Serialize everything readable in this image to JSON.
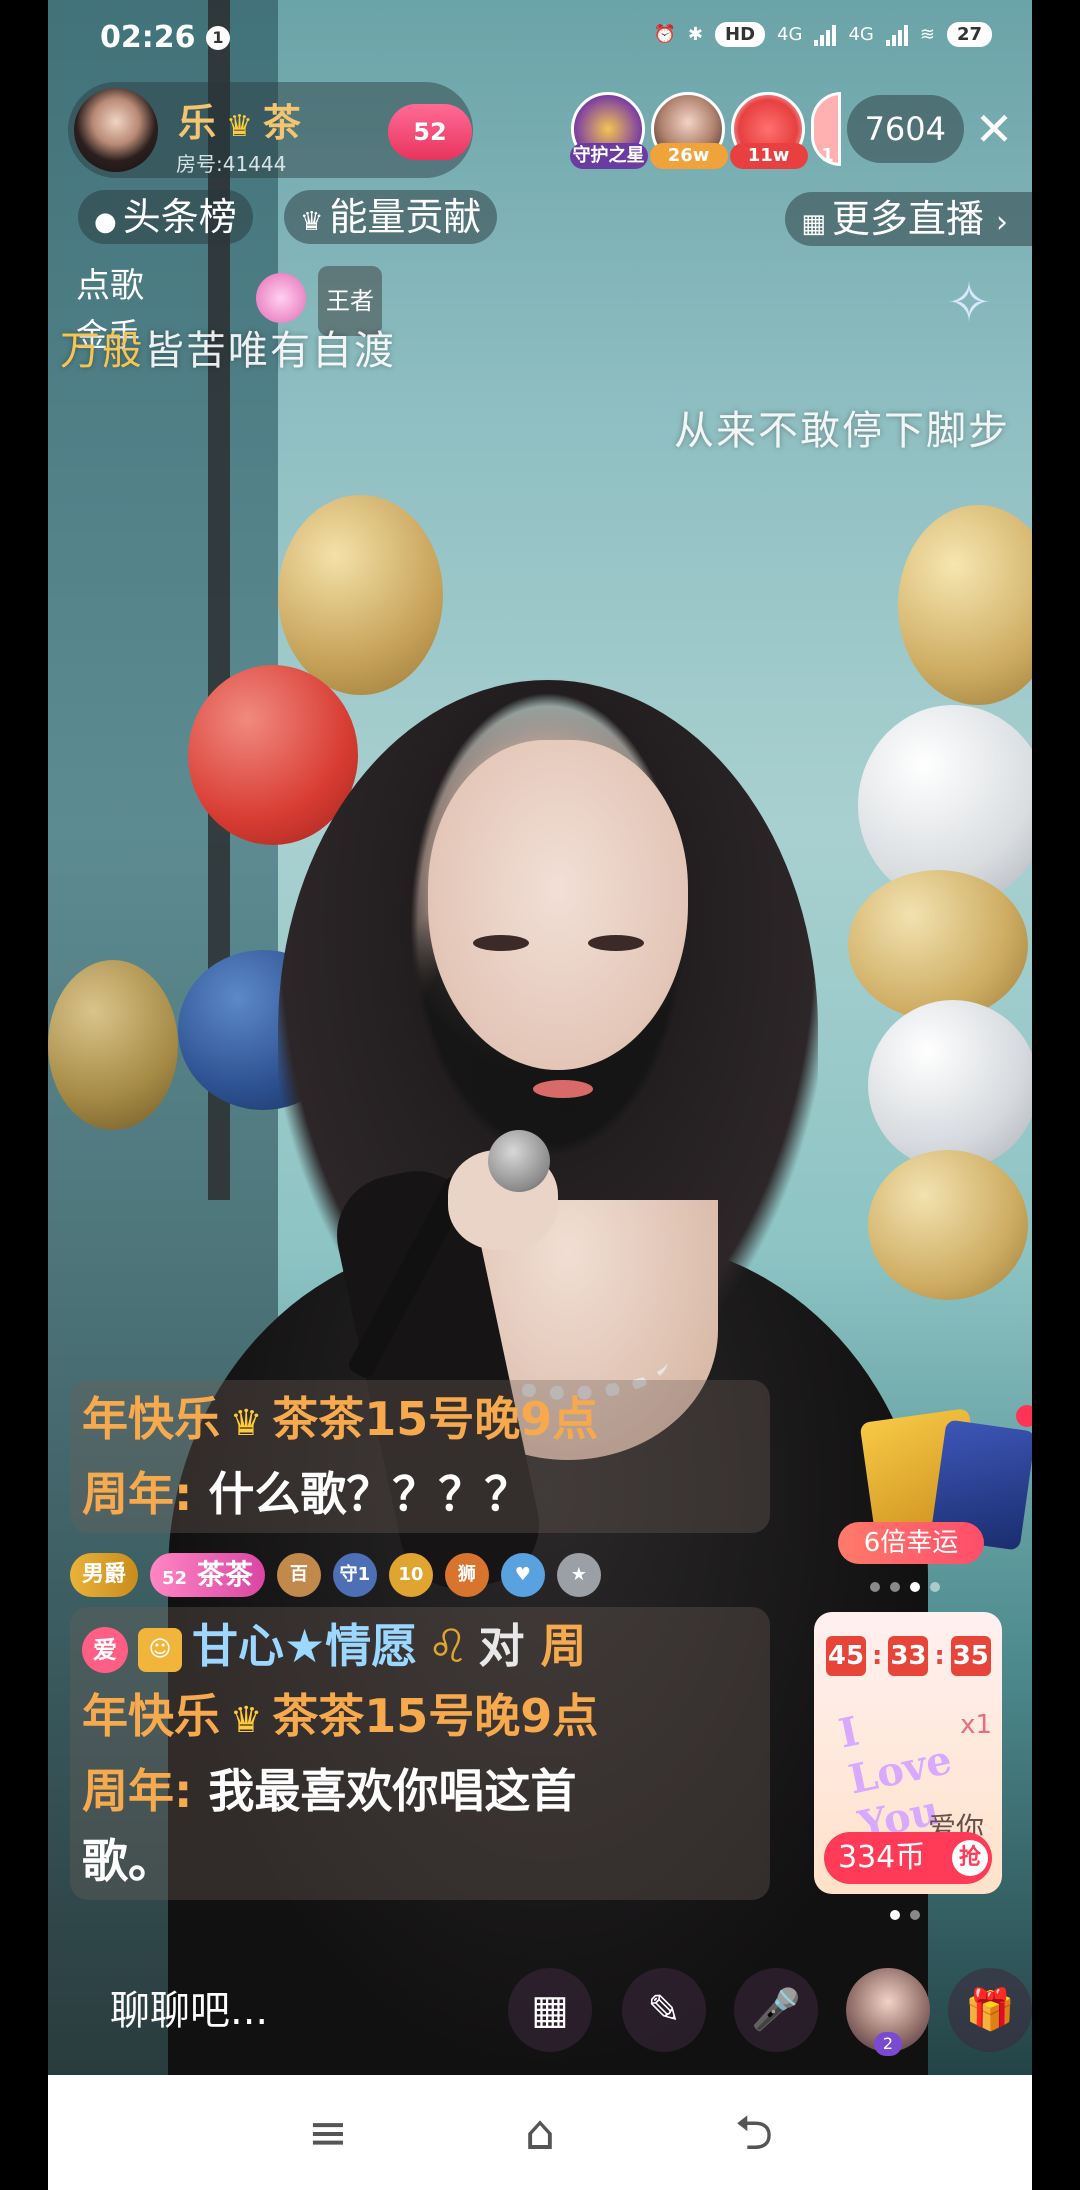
{
  "status_bar": {
    "time": "02:26",
    "notify_count": "1",
    "network_1": "4G",
    "network_2": "4G",
    "hd_label": "HD",
    "battery": "27"
  },
  "host": {
    "name_left": "乐",
    "name_right": "茶",
    "room": "房号:41444",
    "fan_level": "52"
  },
  "top_bar": {
    "guard_label": "守护之星",
    "viewer1_tag": "26w",
    "viewer2_tag": "11w",
    "viewer3_tag": "1",
    "viewer_count": "7604"
  },
  "chips": {
    "toplist": "头条榜",
    "energy": "能量贡献",
    "more_live": "更多直播"
  },
  "song": {
    "label": "点歌",
    "sub": "金手",
    "king_badge": "王者"
  },
  "lyrics": {
    "line1_highlight": "万般",
    "line1_rest": "皆苦唯有自渡",
    "line2": "从来不敢停下脚步"
  },
  "chat": {
    "msg1_line1_a": "年快乐",
    "msg1_line1_b": "茶茶15号晚9点",
    "msg1_line2_prefix": "周年:",
    "msg1_line2_text": "什么歌？？？？",
    "badges": {
      "duke": "男爵",
      "fan_level": "52",
      "fan_name": "茶茶",
      "b1": "百",
      "b2": "守1",
      "b3": "10",
      "b4": "狮",
      "b5": "♥",
      "b6": "★"
    },
    "msg2_ai": "爱",
    "msg2_user": "甘心★情愿",
    "msg2_to": "对",
    "msg2_to_name": "周",
    "msg2_line2_a": "年快乐",
    "msg2_line2_b": "茶茶15号晚9点",
    "msg2_line3_prefix": "周年:",
    "msg2_line3_text": "我最喜欢你唱这首",
    "msg2_line4_text": "歌。"
  },
  "promo": {
    "lucky_label": "6倍幸运"
  },
  "gift_card": {
    "timer_h": "45",
    "timer_m": "33",
    "timer_s": "35",
    "love_text": "I Love You",
    "multiplier": "x1",
    "name": "爱你",
    "price": "334币",
    "grab": "抢"
  },
  "bottom_bar": {
    "chat_placeholder": "聊聊吧...",
    "avatar_badge": "2"
  },
  "icons": [
    "menu-icon",
    "home-icon",
    "back-icon",
    "grid-icon",
    "message-icon",
    "microphone-icon",
    "gift-icon",
    "close-icon",
    "crown-icon"
  ]
}
